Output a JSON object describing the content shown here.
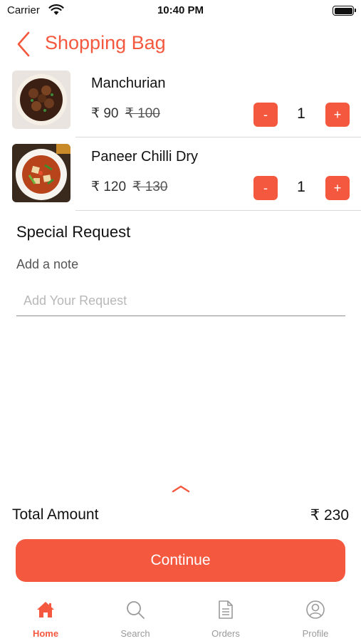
{
  "status_bar": {
    "carrier": "Carrier",
    "time": "10:40 PM"
  },
  "header": {
    "title": "Shopping Bag"
  },
  "cart": {
    "items": [
      {
        "name": "Manchurian",
        "price": "₹ 90",
        "original_price": "₹ 100",
        "quantity": "1",
        "minus_label": "-",
        "plus_label": "+"
      },
      {
        "name": "Paneer Chilli Dry",
        "price": "₹ 120",
        "original_price": "₹ 130",
        "quantity": "1",
        "minus_label": "-",
        "plus_label": "+"
      }
    ]
  },
  "special_request": {
    "title": "Special Request",
    "note_label": "Add a note",
    "placeholder": "Add Your Request",
    "value": ""
  },
  "summary": {
    "total_label": "Total Amount",
    "total_value": "₹ 230"
  },
  "actions": {
    "continue_label": "Continue"
  },
  "tab_bar": {
    "tabs": [
      {
        "label": "Home",
        "icon": "home-icon",
        "active": true
      },
      {
        "label": "Search",
        "icon": "search-icon",
        "active": false
      },
      {
        "label": "Orders",
        "icon": "document-icon",
        "active": false
      },
      {
        "label": "Profile",
        "icon": "user-icon",
        "active": false
      }
    ]
  },
  "colors": {
    "accent": "#f4583f",
    "inactive": "#9a9a9a",
    "divider": "#d9d9d9"
  }
}
